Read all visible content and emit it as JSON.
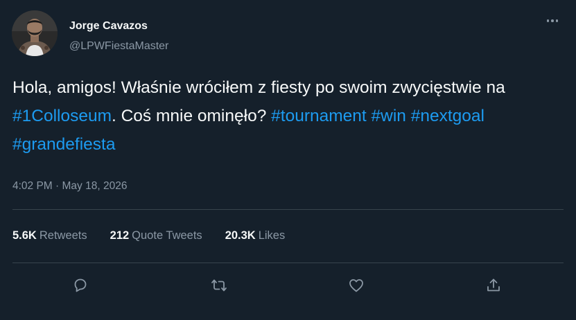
{
  "author": {
    "display_name": "Jorge Cavazos",
    "handle": "@LPWFiestaMaster",
    "avatar_icon": "user-avatar"
  },
  "tweet": {
    "text_part_1": "Hola, amigos! Właśnie wróciłem z fiesty po swoim zwycięstwie na ",
    "hashtag_colloseum": "#1Colloseum",
    "text_part_2": ". Coś mnie ominęło? ",
    "hashtag_tournament": "#tournament",
    "hashtag_win": "#win",
    "hashtag_nextgoal": "#nextgoal",
    "hashtag_grandefiesta": "#grandefiesta",
    "time": "4:02 PM",
    "separator": " · ",
    "date": "May 18, 2026"
  },
  "stats": {
    "retweets_count": "5.6K",
    "retweets_label": "Retweets",
    "quote_tweets_count": "212",
    "quote_tweets_label": "Quote Tweets",
    "likes_count": "20.3K",
    "likes_label": "Likes"
  },
  "actions": {
    "reply_icon": "reply-icon",
    "retweet_icon": "retweet-icon",
    "like_icon": "heart-icon",
    "share_icon": "share-icon",
    "more_icon": "more-icon"
  },
  "colors": {
    "background": "#15202b",
    "text": "#f7f9f9",
    "secondary_text": "#8b98a5",
    "link": "#1d9bf0",
    "divider": "#38444d"
  }
}
